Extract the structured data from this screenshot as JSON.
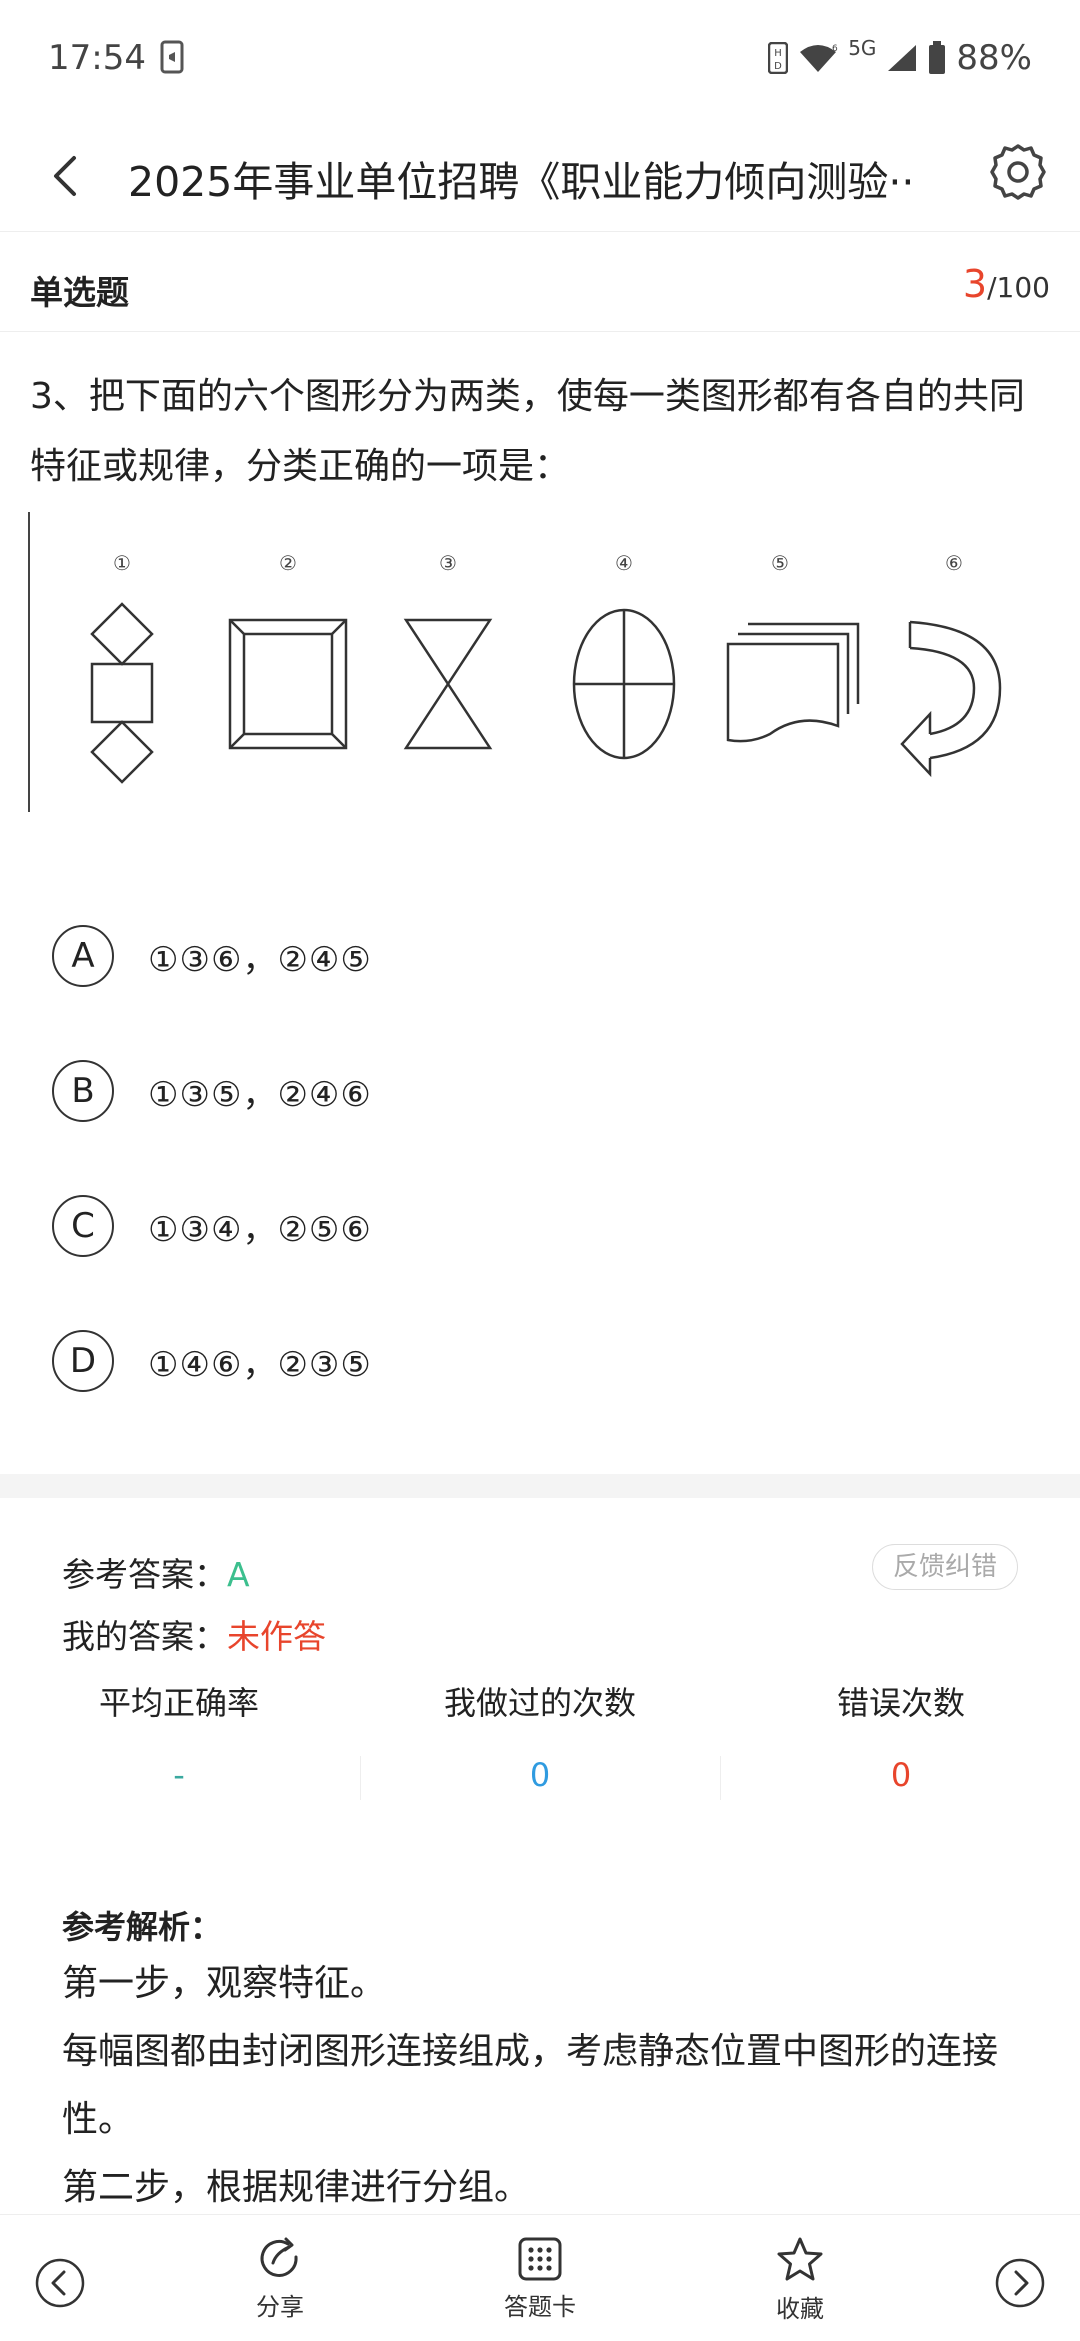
{
  "status": {
    "time": "17:54",
    "battery": "88%",
    "network": "5G"
  },
  "header": {
    "title": "2025年事业单位招聘《职业能力倾向测验··"
  },
  "question_meta": {
    "type_label": "单选题",
    "current": "3",
    "total": "/100"
  },
  "question": {
    "text": "3、把下面的六个图形分为两类，使每一类图形都有各自的共同特征或规律，分类正确的一项是：",
    "figure_labels": [
      "①",
      "②",
      "③",
      "④",
      "⑤",
      "⑥"
    ]
  },
  "options": [
    {
      "letter": "A",
      "text": "①③⑥，②④⑤"
    },
    {
      "letter": "B",
      "text": "①③⑤，②④⑥"
    },
    {
      "letter": "C",
      "text": "①③④，②⑤⑥"
    },
    {
      "letter": "D",
      "text": "①④⑥，②③⑤"
    }
  ],
  "answer": {
    "ref_label": "参考答案：",
    "ref_value": "A",
    "my_label": "我的答案：",
    "my_value": "未作答",
    "feedback_label": "反馈纠错"
  },
  "stats": {
    "avg_label": "平均正确率",
    "avg_value": "-",
    "done_label": "我做过的次数",
    "done_value": "0",
    "wrong_label": "错误次数",
    "wrong_value": "0"
  },
  "analysis": {
    "title": "参考解析：",
    "lines": [
      "第一步，观察特征。",
      "每幅图都由封闭图形连接组成，考虑静态位置中图形的连接性。",
      "第二步，根据规律进行分组。"
    ]
  },
  "bottom_bar": {
    "share_label": "分享",
    "card_label": "答题卡",
    "fav_label": "收藏"
  },
  "colors": {
    "accent_red": "#e8452c",
    "answer_green": "#3cbf8e",
    "count_blue": "#2f9be0",
    "avg_teal": "#3aa99f"
  }
}
